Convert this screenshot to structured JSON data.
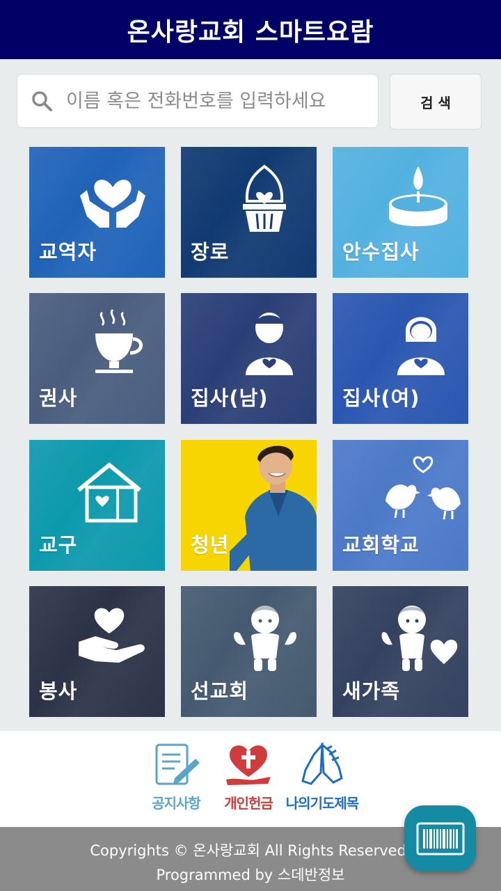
{
  "header": {
    "title": "온사랑교회 스마트요람"
  },
  "search": {
    "placeholder": "이름 혹은 전화번호를 입력하세요",
    "button_label": "검 색"
  },
  "tiles": [
    {
      "label": "교역자",
      "icon": "praying-heart-hands-icon",
      "color": "#1f63b8"
    },
    {
      "label": "장로",
      "icon": "cupcake-heart-icon",
      "color": "#103a72"
    },
    {
      "label": "안수집사",
      "icon": "candle-icon",
      "color": "#53b1e0"
    },
    {
      "label": "권사",
      "icon": "coffee-cup-hearts-icon",
      "color": "#4a5d7f"
    },
    {
      "label": "집사(남)",
      "icon": "man-heart-icon",
      "color": "#2a3f76"
    },
    {
      "label": "집사(여)",
      "icon": "woman-heart-icon",
      "color": "#2b57b1"
    },
    {
      "label": "교구",
      "icon": "house-heart-icon",
      "color": "#0d99ad"
    },
    {
      "label": "청년",
      "icon": "young-man-photo",
      "color": "#f6d500"
    },
    {
      "label": "교회학교",
      "icon": "love-birds-icon",
      "color": "#4c79c8"
    },
    {
      "label": "봉사",
      "icon": "hand-heart-icon",
      "color": "#2c3348"
    },
    {
      "label": "선교회",
      "icon": "cupid-angel-icon",
      "color": "#455a70"
    },
    {
      "label": "새가족",
      "icon": "angel-heart-icon",
      "color": "#34425f"
    }
  ],
  "bottom_nav": [
    {
      "label": "공지사항",
      "icon": "notepad-pen-icon",
      "color": "#5aa5c9"
    },
    {
      "label": "개인헌금",
      "icon": "cross-heart-hand-icon",
      "color": "#d03c3c"
    },
    {
      "label": "나의기도제목",
      "icon": "praying-hands-icon",
      "color": "#1d6dc4"
    }
  ],
  "footer": {
    "line1": "Copyrights © 온사랑교회 All Rights Reserved.",
    "line2": "Programmed by 스데반정보"
  },
  "fab": {
    "icon": "barcode-icon",
    "color": "#148aa3"
  }
}
